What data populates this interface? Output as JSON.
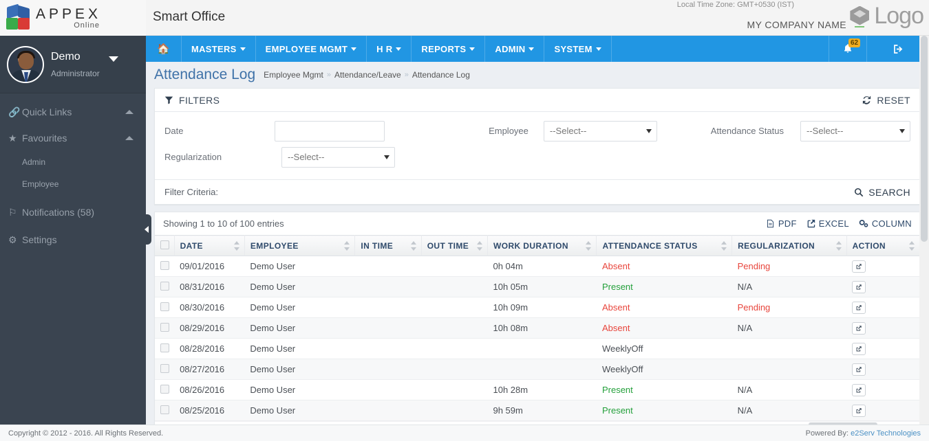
{
  "brand": {
    "name_main": "APPEX",
    "name_sub": "Online",
    "app_title": "Smart Office"
  },
  "header": {
    "timezone": "Local Time Zone: GMT+0530 (IST)",
    "company": "MY COMPANY NAME",
    "logo_word": "Logo"
  },
  "user": {
    "name": "Demo",
    "role": "Administrator"
  },
  "sidebar": {
    "items": [
      {
        "label": "Quick Links",
        "icon": "link-icon"
      },
      {
        "label": "Favourites",
        "icon": "star-icon"
      },
      {
        "label": "Notifications (58)",
        "icon": "flag-icon"
      },
      {
        "label": "Settings",
        "icon": "gears-icon"
      }
    ],
    "favourites_children": [
      {
        "label": "Admin"
      },
      {
        "label": "Employee"
      }
    ]
  },
  "nav": {
    "home": "home-icon",
    "items": [
      {
        "label": "MASTERS"
      },
      {
        "label": "EMPLOYEE MGMT"
      },
      {
        "label": "H R"
      },
      {
        "label": "REPORTS"
      },
      {
        "label": "ADMIN"
      },
      {
        "label": "SYSTEM"
      }
    ],
    "notification_count": "62"
  },
  "page": {
    "title": "Attendance Log",
    "breadcrumb": [
      "Employee Mgmt",
      "Attendance/Leave",
      "Attendance Log"
    ],
    "breadcrumb_sep": "»"
  },
  "filters": {
    "title": "FILTERS",
    "reset_label": "RESET",
    "date_label": "Date",
    "date_value": "",
    "date_placeholder": "",
    "regularization_label": "Regularization",
    "regularization_value": "--Select--",
    "employee_label": "Employee",
    "employee_value": "--Select--",
    "attendance_status_label": "Attendance Status",
    "attendance_status_value": "--Select--",
    "filter_criteria_label": "Filter Criteria:",
    "search_label": "SEARCH"
  },
  "table": {
    "showing": "Showing 1 to 10 of 100 entries",
    "tools": [
      {
        "label": "PDF",
        "icon": "pdf-icon"
      },
      {
        "label": "EXCEL",
        "icon": "excel-icon"
      },
      {
        "label": "COLUMN",
        "icon": "column-icon"
      }
    ],
    "columns": [
      "DATE",
      "EMPLOYEE",
      "IN TIME",
      "OUT TIME",
      "WORK DURATION",
      "ATTENDANCE STATUS",
      "REGULARIZATION",
      "ACTION"
    ],
    "rows": [
      {
        "date": "09/01/2016",
        "employee": "Demo User",
        "in_time": "",
        "out_time": "",
        "work_duration": "0h 04m",
        "status": "Absent",
        "status_kind": "absent",
        "regularization": "Pending",
        "reg_kind": "pending"
      },
      {
        "date": "08/31/2016",
        "employee": "Demo User",
        "in_time": "",
        "out_time": "",
        "work_duration": "10h 05m",
        "status": "Present",
        "status_kind": "present",
        "regularization": "N/A",
        "reg_kind": "na"
      },
      {
        "date": "08/30/2016",
        "employee": "Demo User",
        "in_time": "",
        "out_time": "",
        "work_duration": "10h 09m",
        "status": "Absent",
        "status_kind": "absent",
        "regularization": "Pending",
        "reg_kind": "pending"
      },
      {
        "date": "08/29/2016",
        "employee": "Demo User",
        "in_time": "",
        "out_time": "",
        "work_duration": "10h 08m",
        "status": "Absent",
        "status_kind": "absent",
        "regularization": "N/A",
        "reg_kind": "na"
      },
      {
        "date": "08/28/2016",
        "employee": "Demo User",
        "in_time": "",
        "out_time": "",
        "work_duration": "",
        "status": "WeeklyOff",
        "status_kind": "off",
        "regularization": "",
        "reg_kind": "na"
      },
      {
        "date": "08/27/2016",
        "employee": "Demo User",
        "in_time": "",
        "out_time": "",
        "work_duration": "",
        "status": "WeeklyOff",
        "status_kind": "off",
        "regularization": "",
        "reg_kind": "na"
      },
      {
        "date": "08/26/2016",
        "employee": "Demo User",
        "in_time": "",
        "out_time": "",
        "work_duration": "10h 28m",
        "status": "Present",
        "status_kind": "present",
        "regularization": "N/A",
        "reg_kind": "na"
      },
      {
        "date": "08/25/2016",
        "employee": "Demo User",
        "in_time": "",
        "out_time": "",
        "work_duration": "9h 59m",
        "status": "Present",
        "status_kind": "present",
        "regularization": "N/A",
        "reg_kind": "na"
      }
    ]
  },
  "footer": {
    "copyright": "Copyright © 2012 - 2016. All Rights Reserved.",
    "powered_prefix": "Powered By:",
    "powered_link": "e2Serv Technologies"
  },
  "colors": {
    "nav_blue": "#2196e3",
    "sidebar": "#3a4450",
    "absent_red": "#e8453c",
    "present_green": "#24a03b",
    "badge_yellow": "#f0ad20",
    "title_blue": "#3f72a8"
  }
}
